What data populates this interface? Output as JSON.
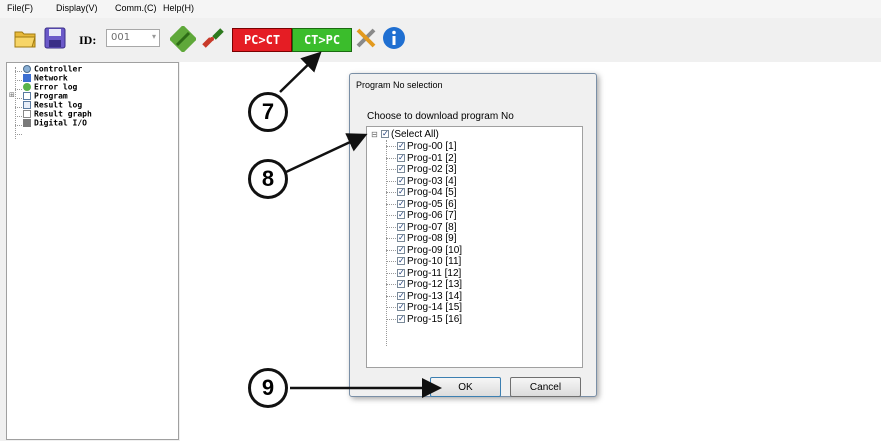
{
  "menu": [
    {
      "label": "File(F)"
    },
    {
      "label": "Display(V)"
    },
    {
      "label": "Comm.(C)"
    },
    {
      "label": "Help(H)"
    }
  ],
  "toolbar": {
    "id_label": "ID:",
    "id_value": "001",
    "pc_to_ct": "PC>CT",
    "ct_to_pc": "CT>PC"
  },
  "tree": [
    {
      "label": "Controller",
      "icon": "controller-icon"
    },
    {
      "label": "Network",
      "icon": "network-icon"
    },
    {
      "label": "Error log",
      "icon": "error-log-icon"
    },
    {
      "label": "Program",
      "icon": "program-icon"
    },
    {
      "label": "Result log",
      "icon": "result-log-icon"
    },
    {
      "label": "Result graph",
      "icon": "result-graph-icon"
    },
    {
      "label": "Digital I/O",
      "icon": "digital-io-icon"
    }
  ],
  "dialog": {
    "title": "Program No selection",
    "instruction": "Choose to download program No",
    "select_all": "(Select All)",
    "ok": "OK",
    "cancel": "Cancel",
    "programs": [
      "Prog-00 [1]",
      "Prog-01 [2]",
      "Prog-02 [3]",
      "Prog-03 [4]",
      "Prog-04 [5]",
      "Prog-05 [6]",
      "Prog-06 [7]",
      "Prog-07 [8]",
      "Prog-08 [9]",
      "Prog-09 [10]",
      "Prog-10 [11]",
      "Prog-11 [12]",
      "Prog-12 [13]",
      "Prog-13 [14]",
      "Prog-14 [15]",
      "Prog-15 [16]"
    ]
  },
  "callouts": {
    "c7": "7",
    "c8": "8",
    "c9": "9"
  }
}
